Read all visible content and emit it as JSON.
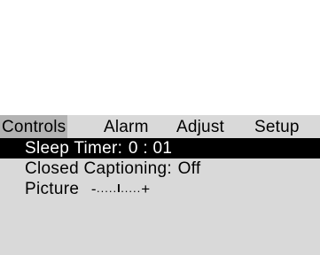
{
  "menu": {
    "tabs": [
      {
        "label": "Controls",
        "active": true
      },
      {
        "label": "Alarm",
        "active": false
      },
      {
        "label": "Adjust",
        "active": false
      },
      {
        "label": "Setup",
        "active": false
      }
    ],
    "items": [
      {
        "label": "Sleep Timer:",
        "value": "0 : 01",
        "selected": true
      },
      {
        "label": "Closed Captioning:",
        "value": "Off",
        "selected": false
      },
      {
        "label": "Picture",
        "slider": {
          "min_symbol": "-",
          "left_dots": ".....",
          "knob": "I",
          "right_dots": ".....",
          "max_symbol": "+",
          "level_fraction": 0.5
        },
        "selected": false
      }
    ]
  },
  "colors": {
    "panel_background": "#d9d9d9",
    "active_tab_background": "#b3b3b3",
    "selection_background": "#000000",
    "selection_text": "#ffffff",
    "text": "#000000",
    "video_background": "#ffffff"
  }
}
